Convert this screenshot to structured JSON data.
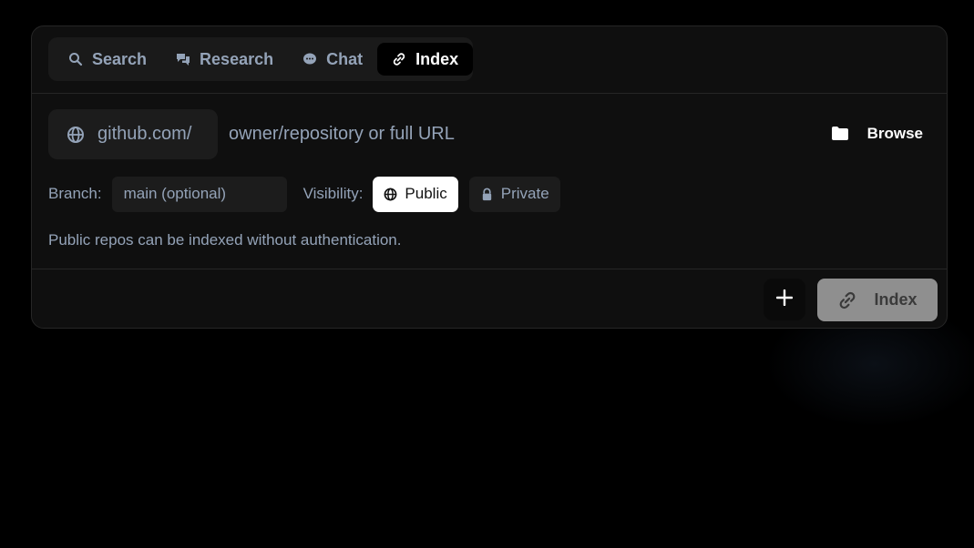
{
  "tabs": [
    {
      "label": "Search",
      "icon": "search-icon",
      "active": false
    },
    {
      "label": "Research",
      "icon": "chat-bubbles-icon",
      "active": false
    },
    {
      "label": "Chat",
      "icon": "chat-bubble-icon",
      "active": false
    },
    {
      "label": "Index",
      "icon": "link-icon",
      "active": true
    }
  ],
  "repo": {
    "prefix": "github.com/",
    "prefix_icon": "globe-icon",
    "placeholder": "owner/repository or full URL",
    "value": ""
  },
  "browse": {
    "label": "Browse",
    "icon": "folder-icon"
  },
  "branch": {
    "label": "Branch:",
    "placeholder": "main (optional)",
    "value": ""
  },
  "visibility": {
    "label": "Visibility:",
    "options": [
      {
        "label": "Public",
        "icon": "globe-icon",
        "selected": true
      },
      {
        "label": "Private",
        "icon": "lock-icon",
        "selected": false
      }
    ]
  },
  "hint": "Public repos can be indexed without authentication.",
  "footer": {
    "add_icon": "plus-icon",
    "submit_label": "Index",
    "submit_icon": "link-icon"
  },
  "colors": {
    "background": "#000000",
    "card": "#0f0f0f",
    "muted_text": "#94a3b8",
    "active_tab": "#000000",
    "selected_option": "#ffffff",
    "disabled_button": "#8f8f8f"
  }
}
